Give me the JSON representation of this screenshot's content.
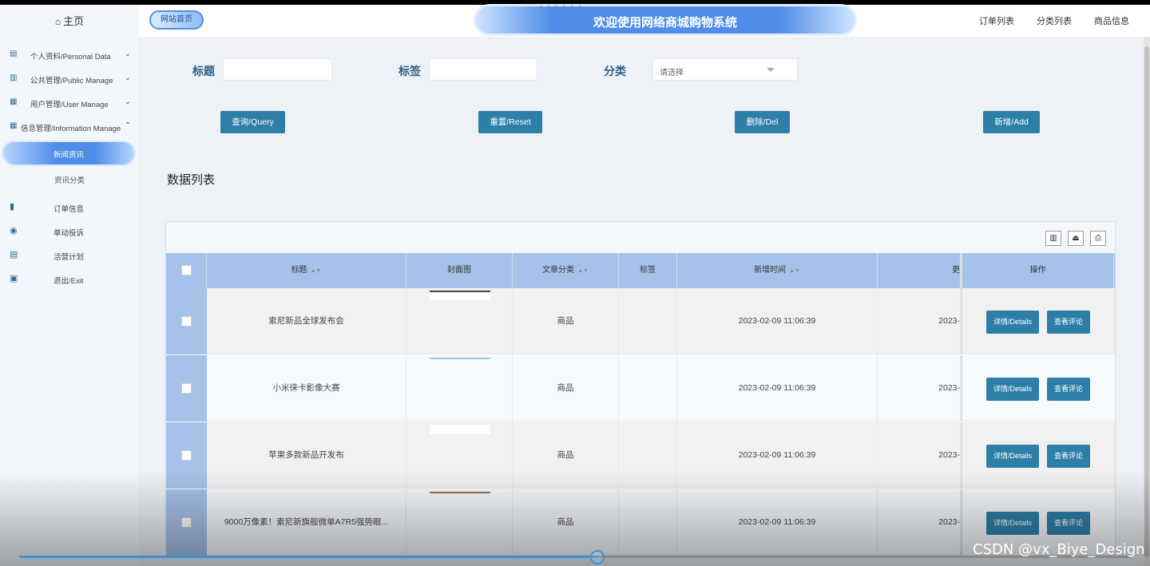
{
  "sidebar": {
    "home_label": "主页",
    "menus": [
      {
        "label": "个人资料/Personal Data"
      },
      {
        "label": "公共管理/Public Manage"
      },
      {
        "label": "用户管理/User Manage"
      },
      {
        "label": "信息管理/Information Manage"
      }
    ],
    "sub_items": [
      {
        "label": "新闻资讯",
        "active": true
      },
      {
        "label": "资讯分类"
      }
    ],
    "flat_items": [
      {
        "label": "订单信息"
      },
      {
        "label": "单动投诉"
      },
      {
        "label": "活营计划"
      },
      {
        "label": "退出/Exit"
      }
    ]
  },
  "header": {
    "site_home": "网站首页",
    "title": "欢迎使用网络商城购物系统",
    "nav": [
      "订单列表",
      "分类列表",
      "商品信息"
    ]
  },
  "filters": {
    "title_label": "标题",
    "tag_label": "标签",
    "category_label": "分类",
    "category_placeholder": "请选择"
  },
  "actions": {
    "query": "查询/Query",
    "reset": "重置/Reset",
    "delete": "删除/Del",
    "add": "新增/Add"
  },
  "section_title": "数据列表",
  "table": {
    "columns": [
      "标题",
      "封面图",
      "文章分类",
      "标签",
      "新增时间",
      "更",
      "操作"
    ],
    "rows": [
      {
        "title": "索尼新品全球发布会",
        "category": "商品",
        "time": "2023-02-09 11:06:39",
        "time2": "2023-",
        "btn1": "详情/Details",
        "btn2": "查看评论"
      },
      {
        "title": "小米徕卡影像大赛",
        "category": "商品",
        "time": "2023-02-09 11:06:39",
        "time2": "2023-",
        "btn1": "详情/Details",
        "btn2": "查看评论"
      },
      {
        "title": "苹果多款新品开发布",
        "category": "商品",
        "time": "2023-02-09 11:06:39",
        "time2": "2023-",
        "btn1": "详情/Details",
        "btn2": "查看评论"
      },
      {
        "title": "9000万像素！索尼新旗舰微单A7R5强势眼...",
        "category": "商品",
        "time": "2023-02-09 11:06:39",
        "time2": "2023-",
        "btn1": "详情/Details",
        "btn2": "查看评论"
      }
    ]
  },
  "player": {
    "progress": 0.52,
    "watermark": "CSDN @vx_Biye_Design"
  },
  "colors": {
    "accent": "#2e7fa8",
    "header_row": "#a6c2ea",
    "banner": "#4f8de8"
  }
}
